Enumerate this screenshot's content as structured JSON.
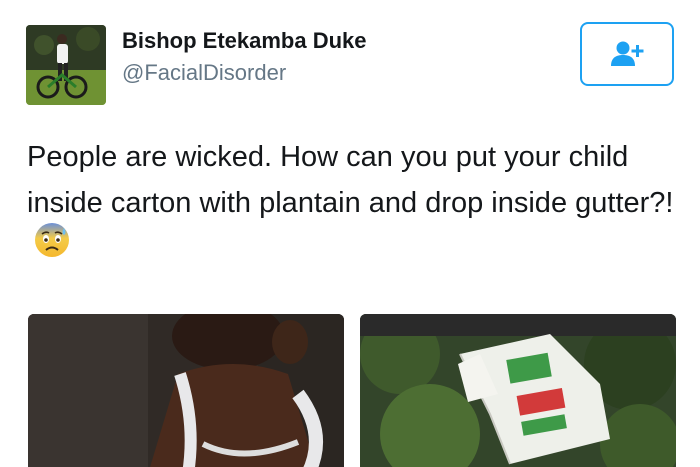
{
  "tweet": {
    "user": {
      "display_name": "Bishop Etekamba Duke",
      "handle": "@FacialDisorder"
    },
    "text": "People are wicked. How can you put your child inside carton with plantain and drop inside gutter?!",
    "emoji": "anxious-face-with-sweat",
    "follow_icon": "add-user-icon",
    "media": [
      {
        "description_icon": "photo-child"
      },
      {
        "description_icon": "photo-carton-in-gutter"
      }
    ]
  },
  "colors": {
    "accent": "#1da1f2",
    "text": "#14171a",
    "secondary_text": "#657786"
  }
}
